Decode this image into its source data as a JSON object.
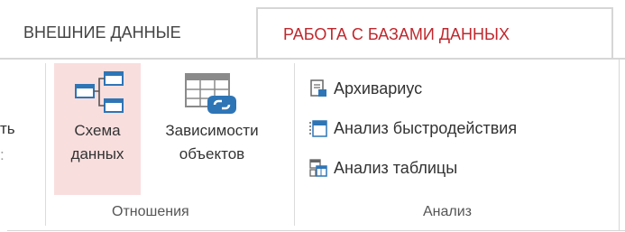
{
  "tabs": {
    "external": "ВНЕШНИЕ ДАННЫЕ",
    "database_tools": "РАБОТА С БАЗАМИ ДАННЫХ"
  },
  "clipped": {
    "label_line1": "ть",
    "label_line2": ":"
  },
  "relations_group": {
    "label": "Отношения",
    "schema_button": {
      "line1": "Схема",
      "line2": "данных"
    },
    "dependencies_button": {
      "line1": "Зависимости",
      "line2": "объектов"
    }
  },
  "analysis_group": {
    "label": "Анализ",
    "items": [
      {
        "label": "Архивариус",
        "icon": "documenter-icon"
      },
      {
        "label": "Анализ быстродействия",
        "icon": "performance-icon"
      },
      {
        "label": "Анализ таблицы",
        "icon": "table-analyzer-icon"
      }
    ]
  },
  "colors": {
    "active_tab_text": "#c0272d",
    "selected_button_bg": "#f9dede",
    "icon_blue": "#2e75b6"
  }
}
